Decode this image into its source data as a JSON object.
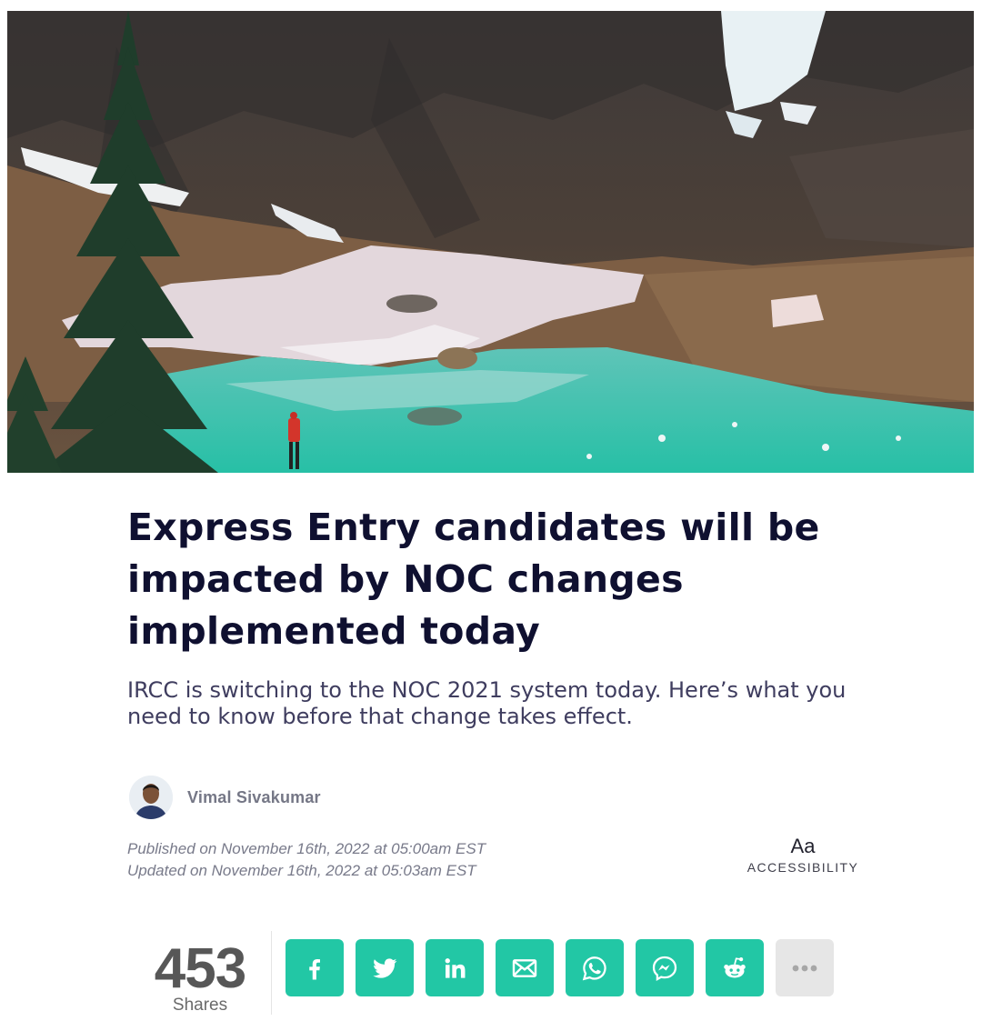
{
  "article": {
    "title": "Express Entry candidates will be impacted by NOC changes implemented today",
    "subtitle": "IRCC is switching to the NOC 2021 system today. Here’s what you need to know before that change takes effect.",
    "author": "Vimal Sivakumar",
    "published": "Published on November 16th, 2022 at 05:00am EST",
    "updated": "Updated on November 16th, 2022 at 05:03am EST"
  },
  "accessibility": {
    "icon_text": "Aa",
    "label": "ACCESSIBILITY"
  },
  "share": {
    "count": "453",
    "count_label": "Shares",
    "buttons": [
      {
        "icon": "facebook-icon"
      },
      {
        "icon": "twitter-icon"
      },
      {
        "icon": "linkedin-icon"
      },
      {
        "icon": "email-icon"
      },
      {
        "icon": "whatsapp-icon"
      },
      {
        "icon": "messenger-icon"
      },
      {
        "icon": "reddit-icon"
      },
      {
        "icon": "more-icon"
      }
    ],
    "accent_color": "#22c7a5",
    "more_color": "#e6e6e6"
  },
  "colors": {
    "title": "#0f1030",
    "subtitle": "#3f3d5f",
    "meta": "#787a8a"
  }
}
